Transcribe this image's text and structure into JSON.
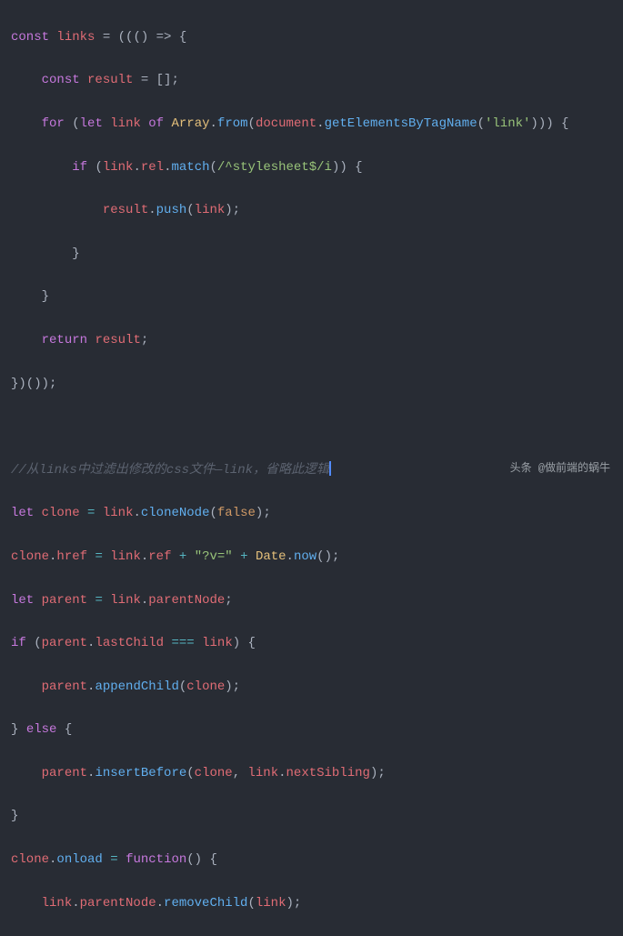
{
  "code": {
    "l1_const": "const",
    "l1_links": "links",
    "l1_rest": " = ((() => {",
    "l2_const": "const",
    "l2_result": "result",
    "l2_rest": " = [];",
    "l3_for": "for",
    "l3_let": "let",
    "l3_link": "link",
    "l3_of": "of",
    "l3_array": "Array",
    "l3_from": "from",
    "l3_document": "document",
    "l3_gtfn": "getElementsByTagName",
    "l3_str": "'link'",
    "l4_if": "if",
    "l4_link": "link",
    "l4_rel": "rel",
    "l4_match": "match",
    "l4_regex": "/^stylesheet$/i",
    "l5_result": "result",
    "l5_push": "push",
    "l5_link": "link",
    "l9_return": "return",
    "l9_result": "result",
    "comment": "//从links中过滤出修改的css文件—link，省略此逻辑",
    "l13_let": "let",
    "l13_clone": "clone",
    "l13_link": "link",
    "l13_cloneNode": "cloneNode",
    "l13_false": "false",
    "l14_clone": "clone",
    "l14_href": "href",
    "l14_link": "link",
    "l14_ref": "ref",
    "l14_str": "\"?v=\"",
    "l14_date": "Date",
    "l14_now": "now",
    "l15_let": "let",
    "l15_parent": "parent",
    "l15_link": "link",
    "l15_parentNode": "parentNode",
    "l16_if": "if",
    "l16_parent": "parent",
    "l16_lastChild": "lastChild",
    "l16_link": "link",
    "l17_parent": "parent",
    "l17_appendChild": "appendChild",
    "l17_clone": "clone",
    "l18_else": "else",
    "l19_parent": "parent",
    "l19_insertBefore": "insertBefore",
    "l19_clone": "clone",
    "l19_link": "link",
    "l19_nextSibling": "nextSibling",
    "l21_clone": "clone",
    "l21_onload": "onload",
    "l21_function": "function",
    "l22_link": "link",
    "l22_parentNode": "parentNode",
    "l22_removeChild": "removeChild",
    "l22_link2": "link"
  },
  "watermark": "头条 @做前端的蜗牛"
}
